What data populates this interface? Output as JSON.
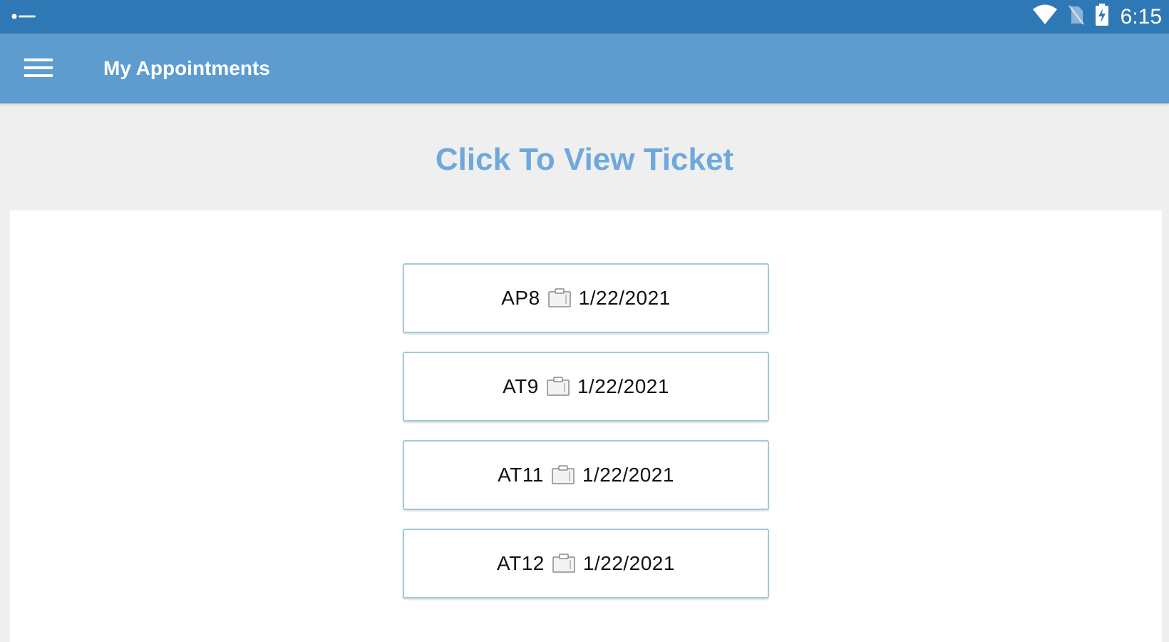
{
  "status_bar": {
    "time": "6:15",
    "icons": [
      "notification-dots-icon",
      "wifi-icon",
      "no-sim-icon",
      "battery-charging-icon"
    ]
  },
  "app_bar": {
    "title": "My Appointments",
    "menu_icon": "hamburger-menu-icon"
  },
  "heading": "Click To View Ticket",
  "tickets": [
    {
      "code": "AP8",
      "date": "1/22/2021",
      "icon": "clipboard-icon"
    },
    {
      "code": "AT9",
      "date": "1/22/2021",
      "icon": "clipboard-icon"
    },
    {
      "code": "AT11",
      "date": "1/22/2021",
      "icon": "clipboard-icon"
    },
    {
      "code": "AT12",
      "date": "1/22/2021",
      "icon": "clipboard-icon"
    }
  ],
  "colors": {
    "status_bar": "#2f78b6",
    "app_bar": "#5e9ccf",
    "heading_text": "#6fa8dc",
    "button_border": "#9ecbd6",
    "background": "#efefef"
  }
}
